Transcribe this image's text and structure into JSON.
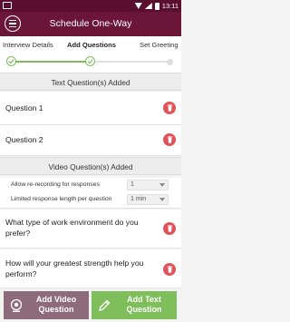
{
  "status_bar": {
    "time": "13:11"
  },
  "app_bar": {
    "title": "Schedule One-Way"
  },
  "steps": [
    {
      "label": "Interview Details",
      "state": "done"
    },
    {
      "label": "Add Questions",
      "state": "active"
    },
    {
      "label": "Set Greeting",
      "state": "pending"
    }
  ],
  "text_section": {
    "header": "Text Question(s) Added",
    "questions": [
      "Question 1",
      "Question 2"
    ]
  },
  "video_section": {
    "header": "Video Question(s) Added",
    "settings": [
      {
        "label": "Allow re-recording for responses",
        "value": "1"
      },
      {
        "label": "Limited response length per question",
        "value": "1 min"
      }
    ],
    "questions": [
      "What type of work environment do you prefer?",
      "How will your greatest strength help you perform?"
    ]
  },
  "buttons": {
    "add_video": "Add Video Question",
    "add_text": "Add Text Question"
  },
  "colors": {
    "status_bar": "#5b0f2e",
    "app_bar": "#6b1538",
    "progress": "#7cbf59",
    "delete": "#e05359",
    "video_button": "#8e6b7b",
    "text_button": "#7fbf5b"
  }
}
